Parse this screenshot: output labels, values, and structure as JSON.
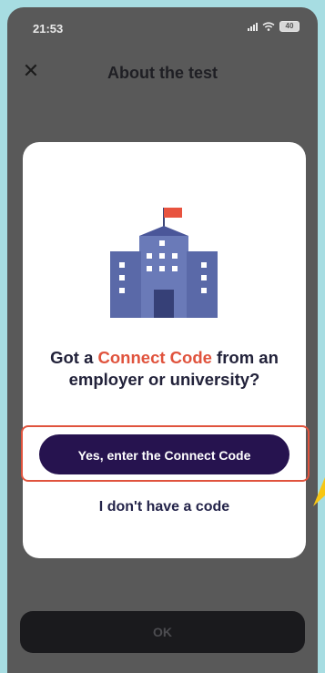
{
  "status_bar": {
    "time": "21:53",
    "battery": "40"
  },
  "header": {
    "title": "About the test"
  },
  "modal": {
    "headline_part1": "Got a ",
    "headline_accent": "Connect Code",
    "headline_part2": " from an employer or university?",
    "primary_button": "Yes, enter the Connect Code",
    "secondary_link": "I don't have a code"
  },
  "footer": {
    "ok_label": "OK"
  },
  "colors": {
    "accent": "#e0533d",
    "primary": "#26134f",
    "backdrop": "#595959",
    "outer_background": "#a7dde2"
  },
  "icons": [
    "close-icon",
    "signal-icon",
    "wifi-icon",
    "battery-icon",
    "building-illustration",
    "pointer-arrow-icon"
  ]
}
